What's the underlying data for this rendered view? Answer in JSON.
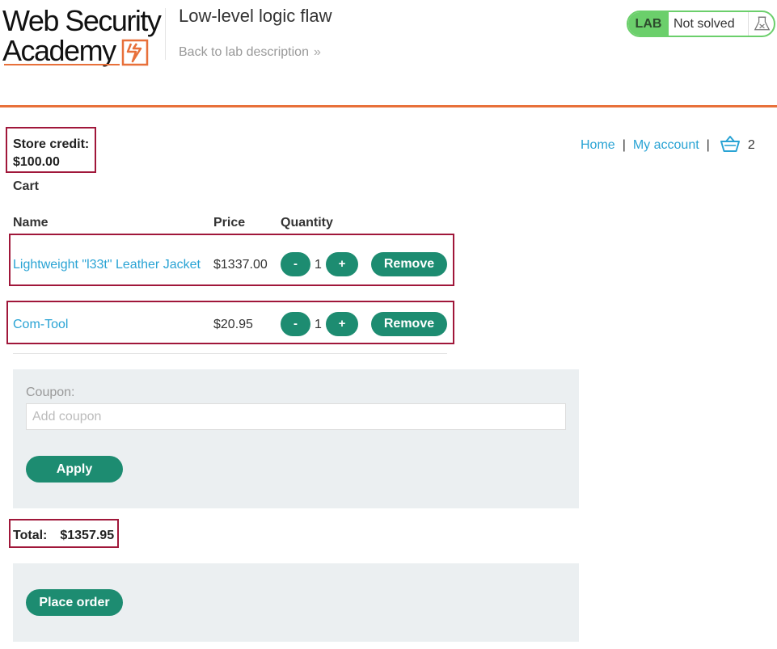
{
  "logo": {
    "line1": "Web Security",
    "line2": "Academy"
  },
  "lab": {
    "title": "Low-level logic flaw",
    "back_link": "Back to lab description",
    "badge_label": "LAB",
    "status": "Not solved"
  },
  "nav": {
    "home": "Home",
    "my_account": "My account",
    "separator": "|",
    "cart_count": "2"
  },
  "store_credit": {
    "label": "Store credit:",
    "value": "$100.00"
  },
  "cart": {
    "title": "Cart",
    "headers": {
      "name": "Name",
      "price": "Price",
      "quantity": "Quantity"
    },
    "items": [
      {
        "name": "Lightweight \"l33t\" Leather Jacket",
        "price": "$1337.00",
        "quantity": "1",
        "minus": "-",
        "plus": "+",
        "remove": "Remove"
      },
      {
        "name": "Com-Tool",
        "price": "$20.95",
        "quantity": "1",
        "minus": "-",
        "plus": "+",
        "remove": "Remove"
      }
    ]
  },
  "coupon": {
    "label": "Coupon:",
    "placeholder": "Add coupon",
    "apply": "Apply"
  },
  "total": {
    "label": "Total:",
    "value": "$1357.95"
  },
  "place_order": "Place order",
  "colors": {
    "accent_orange": "#e8703a",
    "button_green": "#1d8c71",
    "link_blue": "#29a3d4",
    "highlight_red": "#a0173a",
    "badge_green": "#6bcf6b"
  },
  "icons": {
    "cart": "basket-icon",
    "flask": "flask-icon",
    "chevron": "double-chevron-right-icon",
    "logo_mark": "lightning-bolt-icon"
  }
}
